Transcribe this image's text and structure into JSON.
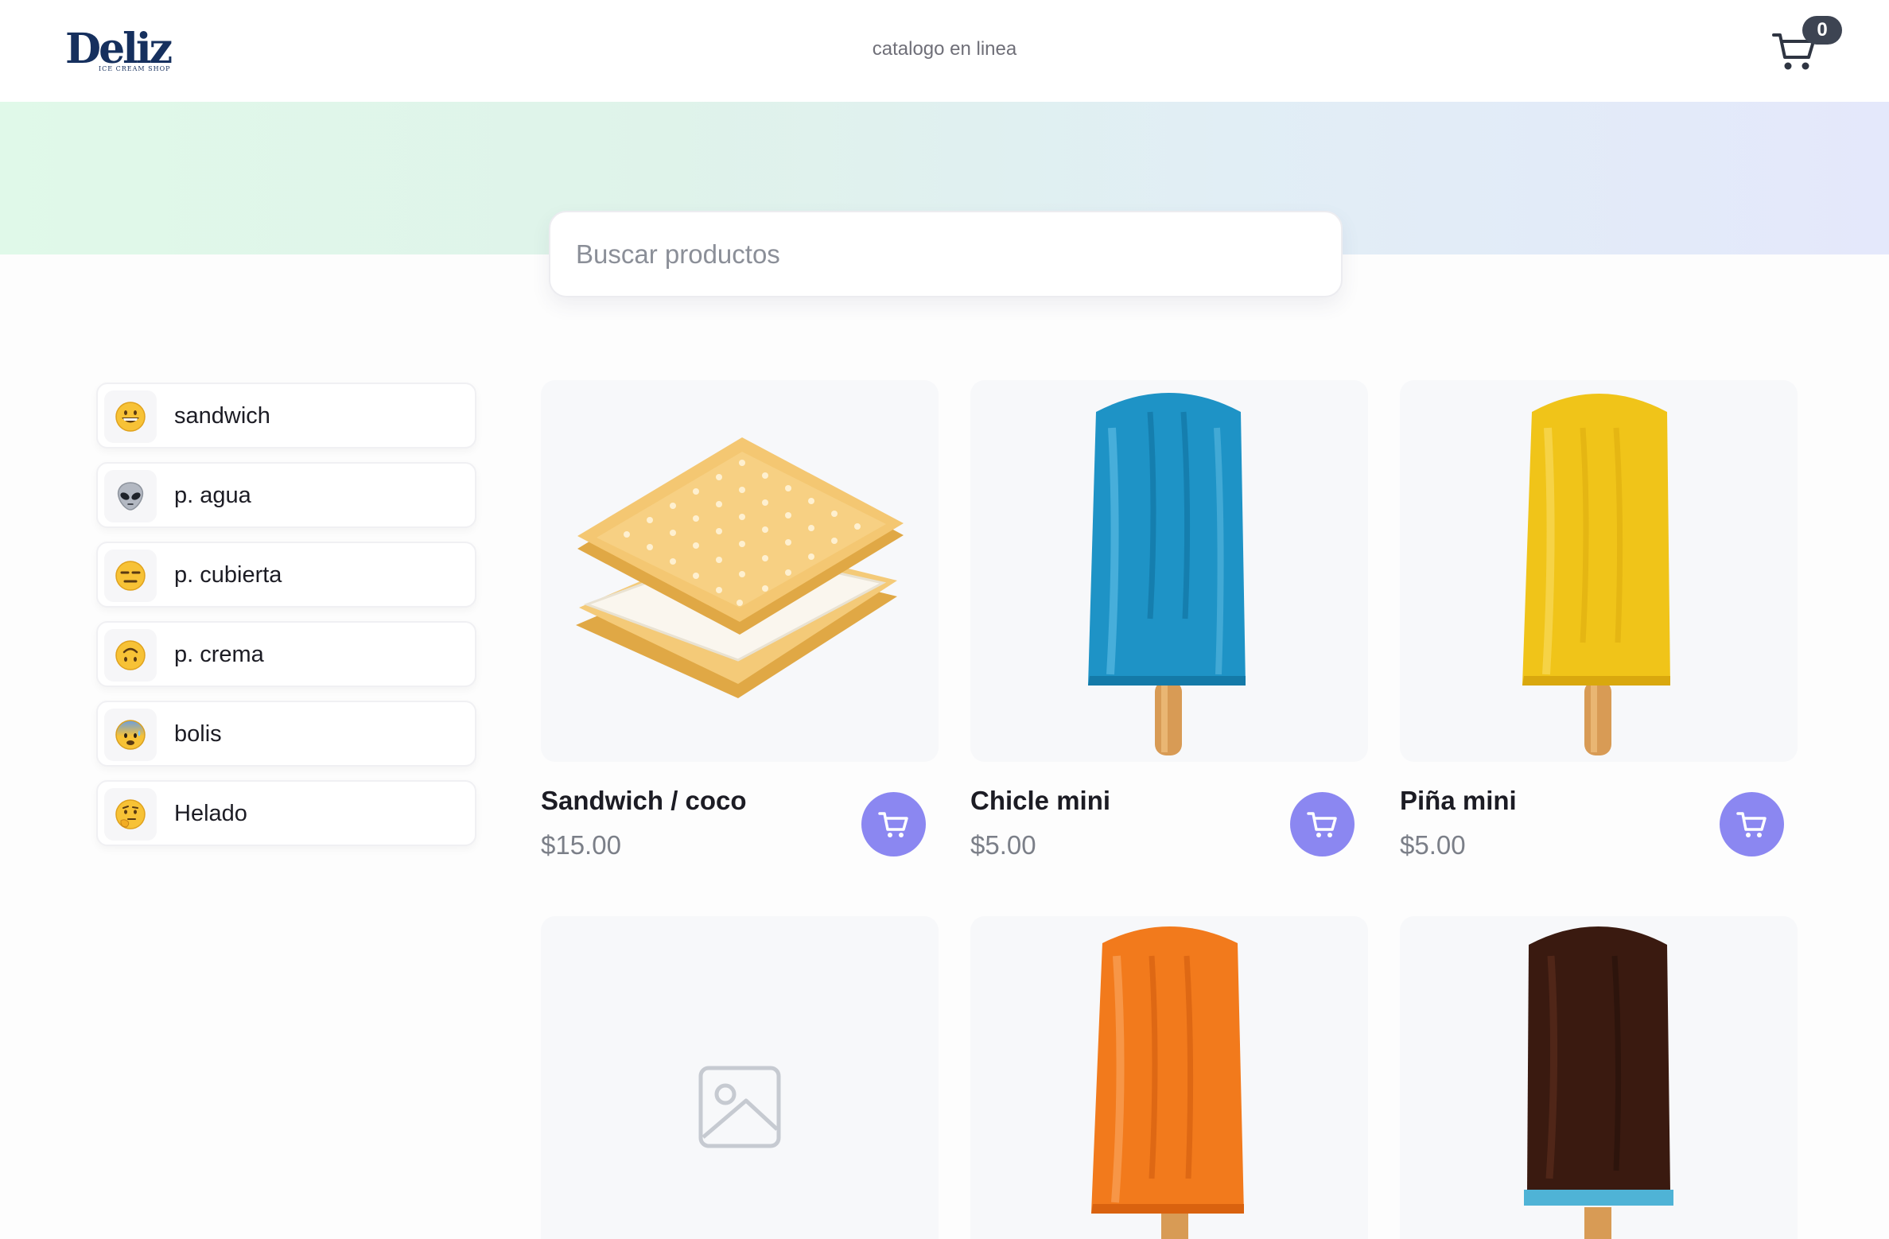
{
  "header": {
    "logo_text": "Deliz",
    "logo_subtitle": "ICE CREAM SHOP",
    "tagline": "catalogo en linea",
    "cart_count": "0",
    "cart_icon": "shopping-cart-icon"
  },
  "search": {
    "placeholder": "Buscar productos",
    "value": ""
  },
  "categories": [
    {
      "label": "sandwich",
      "icon": "grinning-face-emoji"
    },
    {
      "label": "p. agua",
      "icon": "alien-emoji"
    },
    {
      "label": "p. cubierta",
      "icon": "expressionless-face-emoji"
    },
    {
      "label": "p. crema",
      "icon": "upside-down-face-emoji"
    },
    {
      "label": "bolis",
      "icon": "anxious-face-emoji"
    },
    {
      "label": "Helado",
      "icon": "thinking-face-emoji"
    }
  ],
  "products": [
    {
      "name": "Sandwich / coco",
      "price": "$15.00",
      "image": "ice-cream-sandwich"
    },
    {
      "name": "Chicle mini",
      "price": "$5.00",
      "image": "blue-popsicle"
    },
    {
      "name": "Piña mini",
      "price": "$5.00",
      "image": "yellow-popsicle"
    },
    {
      "name": "",
      "price": "",
      "image": "image-placeholder-icon"
    },
    {
      "name": "",
      "price": "",
      "image": "orange-popsicle"
    },
    {
      "name": "",
      "price": "",
      "image": "chocolate-popsicle"
    }
  ],
  "colors": {
    "accent": "#8b87f1",
    "badge": "#3d4452",
    "brand": "#16305e"
  }
}
